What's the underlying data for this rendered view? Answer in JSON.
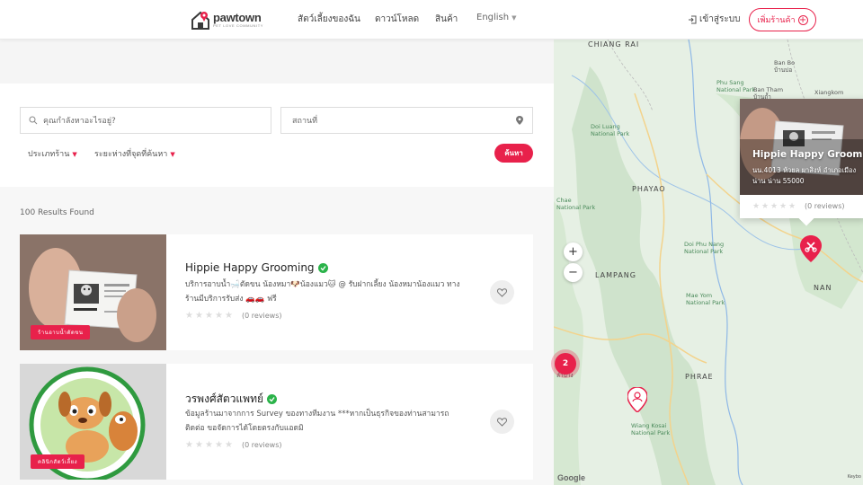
{
  "brand": {
    "name": "pawtown",
    "tagline": "PET LOVE COMMUNITY"
  },
  "nav": {
    "pets": "สัตว์เลี้ยงของฉัน",
    "download": "ดาวน์โหลด",
    "products": "สินค้า",
    "language": "English"
  },
  "header": {
    "login": "เข้าสู่ระบบ",
    "add_store": "เพิ่มร้านค้า"
  },
  "search": {
    "query_placeholder": "คุณกำลังหาอะไรอยู่?",
    "location_placeholder": "สถานที่",
    "store_type": "ประเภทร้าน",
    "distance": "ระยะห่างที่จุดที่ค้นหา",
    "button": "ค้นหา"
  },
  "results": {
    "count_label": "100 Results Found"
  },
  "listings": [
    {
      "name": "Hippie Happy Grooming",
      "category": "ร้านอาบน้ำตัดขน",
      "description": "บริการอาบน้ำ🛁ตัดขน น้องหมา🐶น้องแมว🐱 @ รับฝากเลี้ยง น้องหมาน้องแมว ทางร้านมีบริการรับส่ง 🚗🚗 ฟรี",
      "reviews": "(0 reviews)",
      "rating": 0
    },
    {
      "name": "วรพงศ์สัตวแพทย์",
      "category": "คลินิกสัตว์เลี้ยง",
      "description": "ข้อมูลร้านมาจากการ Survey ของทางทีมงาน ***หากเป็นธุรกิจของท่านสามารถติดต่อ ขอจัดการได้โดยตรงกับแอดมิ",
      "reviews": "(0 reviews)",
      "rating": 0
    }
  ],
  "map": {
    "labels": {
      "chiang_rai": "CHIANG RAI",
      "phayao": "PHAYAO",
      "lampang": "LAMPANG",
      "phrae": "PHRAE",
      "nan": "NAN"
    },
    "parks": {
      "phu_sang": "Phu Sang\nNational Park",
      "doi_luang": "Doi Luang\nNational Park",
      "chae": "Chae\nNational Park",
      "doi_phu_nang": "Doi Phu Nang\nNational Park",
      "mae_yom": "Mae Yom\nNational Park",
      "wiang_kosai": "Wiang Kosai\nNational Park"
    },
    "towns": {
      "ban_bo": "Ban Bo\nบ้านบ่อ",
      "ban_tham": "Ban Tham\nบ้านถ้ำ",
      "xiangkom": "Xiangkom",
      "lampang_th": "ลำปาง"
    },
    "zoom_in": "+",
    "zoom_out": "−",
    "cluster_count": "2",
    "attribution": "Google",
    "keyboard": "Keybo",
    "popup": {
      "title": "Hippie Happy Grooming",
      "address": "นน.4013 ห้วยล ผาสิงห์ อำเภอเมือง น่าน น่าน 55000",
      "reviews": "(0 reviews)"
    }
  },
  "colors": {
    "accent": "#e8214b",
    "verified": "#2bb34a"
  }
}
